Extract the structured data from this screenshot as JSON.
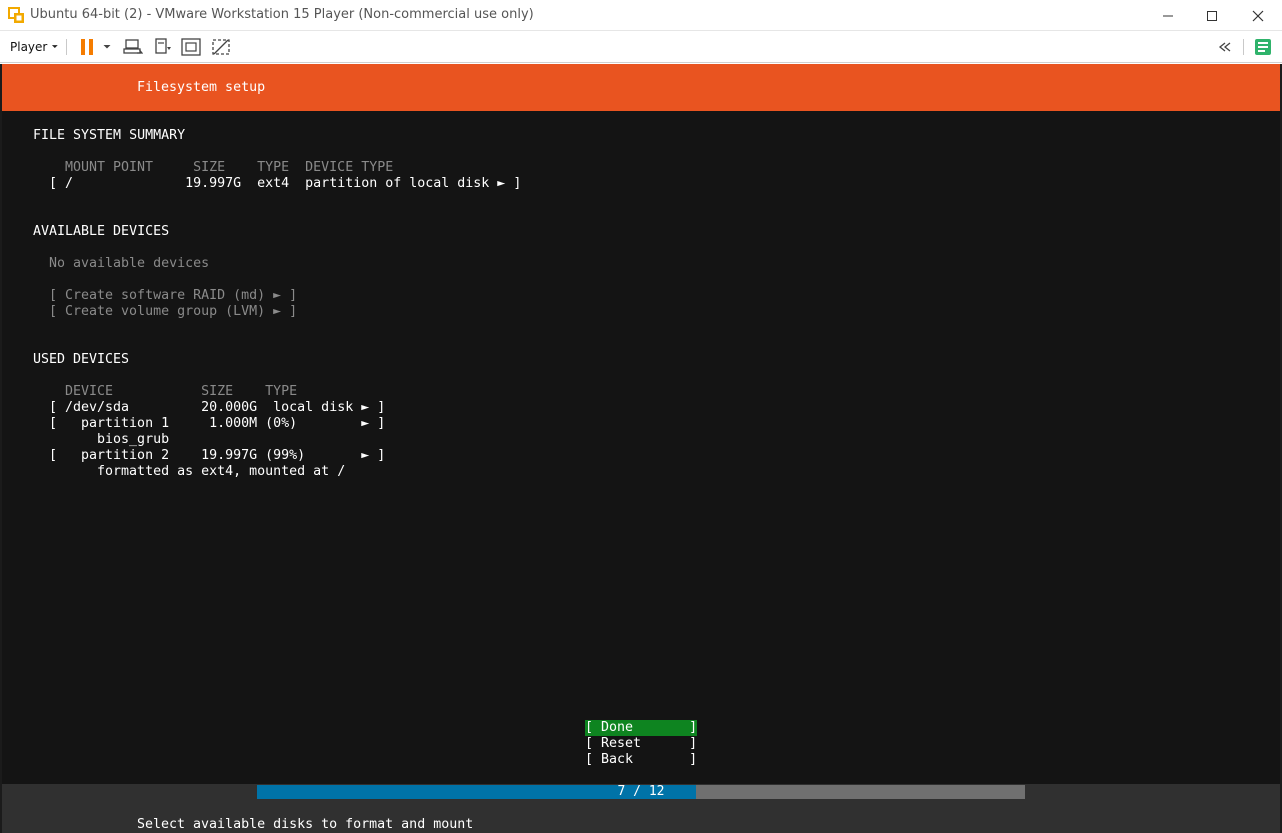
{
  "window": {
    "title": "Ubuntu 64-bit (2) - VMware Workstation 15 Player (Non-commercial use only)",
    "icons": [
      "vmware-app-icon",
      "minimize-icon",
      "maximize-icon",
      "close-icon"
    ]
  },
  "toolbar": {
    "player_label": "Player",
    "icons": [
      "chevron-down-icon",
      "pause-icon",
      "send-ctrl-alt-del-icon",
      "removable-devices-icon",
      "fullscreen-icon",
      "unity-icon",
      "collapse-icon",
      "library-icon"
    ],
    "accent": "#f57c00"
  },
  "installer": {
    "header_title": "Filesystem setup",
    "header_color": "#e95420",
    "fs_summary": {
      "title": "FILE SYSTEM SUMMARY",
      "header": "MOUNT POINT     SIZE    TYPE  DEVICE TYPE",
      "rows": [
        "[ /              19.997G  ext4  partition of local disk ► ]"
      ]
    },
    "available": {
      "title": "AVAILABLE DEVICES",
      "empty": "No available devices",
      "actions": [
        "[ Create software RAID (md) ► ]",
        "[ Create volume group (LVM) ► ]"
      ]
    },
    "used": {
      "title": "USED DEVICES",
      "header": "DEVICE           SIZE    TYPE",
      "lines": [
        "[ /dev/sda         20.000G  local disk ► ]",
        "[   partition 1     1.000M (0%)        ► ]",
        "      bios_grub",
        "[   partition 2    19.997G (99%)       ► ]",
        "      formatted as ext4, mounted at /"
      ]
    },
    "buttons": {
      "done": "[ Done       ]",
      "reset": "[ Reset      ]",
      "back": "[ Back       ]",
      "done_color": "#0e8420"
    },
    "progress": {
      "label": "7 / 12",
      "current": 7,
      "total": 12,
      "color": "#0073a8"
    },
    "footer_hint": "Select available disks to format and mount"
  }
}
